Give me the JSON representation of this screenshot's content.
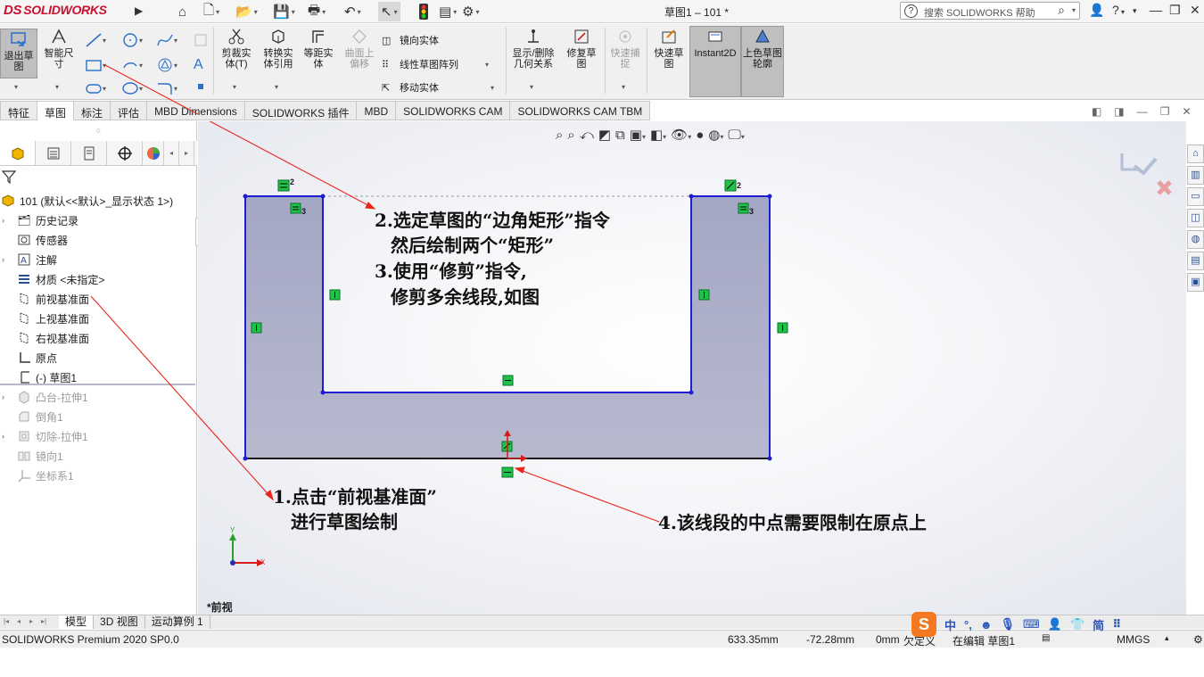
{
  "titlebar": {
    "logo_prefix": "DS",
    "logo_text": "SOLIDWORKS",
    "doc_title": "草图1 – 101 *",
    "help_placeholder": "搜索 SOLIDWORKS 帮助",
    "help_icon": "?"
  },
  "cmd": {
    "exit_sketch": "退出草图",
    "smart_dim": "智能尺寸",
    "trim": "剪裁实体(T)",
    "convert": "转换实体引用",
    "offset": "等距实体",
    "surface_offset": "曲面上偏移",
    "mirror": "镜向实体",
    "linear_pattern": "线性草图阵列",
    "move": "移动实体",
    "show_delete_rel": "显示/删除几何关系",
    "repair": "修复草图",
    "quick_snaps": "快速捕捉",
    "rapid_sketch": "快速草图",
    "instant2d": "Instant2D",
    "shaded_contours": "上色草图轮廓"
  },
  "tabs": [
    "特征",
    "草图",
    "标注",
    "评估",
    "MBD Dimensions",
    "SOLIDWORKS 插件",
    "MBD",
    "SOLIDWORKS CAM",
    "SOLIDWORKS CAM TBM"
  ],
  "active_tab": "草图",
  "tree": {
    "root": "101  (默认<<默认>_显示状态 1>)",
    "items": [
      {
        "label": "历史记录",
        "expand": true,
        "grey": false
      },
      {
        "label": "传感器",
        "expand": false,
        "grey": false
      },
      {
        "label": "注解",
        "expand": true,
        "grey": false
      },
      {
        "label": "材质 <未指定>",
        "expand": false,
        "grey": false
      },
      {
        "label": "前视基准面",
        "expand": false,
        "grey": false
      },
      {
        "label": "上视基准面",
        "expand": false,
        "grey": false
      },
      {
        "label": "右视基准面",
        "expand": false,
        "grey": false
      },
      {
        "label": "原点",
        "expand": false,
        "grey": false
      },
      {
        "label": "(-) 草图1",
        "expand": false,
        "grey": false
      },
      {
        "label": "凸台-拉伸1",
        "expand": true,
        "grey": true
      },
      {
        "label": "倒角1",
        "expand": false,
        "grey": true
      },
      {
        "label": "切除-拉伸1",
        "expand": true,
        "grey": true
      },
      {
        "label": "镜向1",
        "expand": false,
        "grey": true
      },
      {
        "label": "坐标系1",
        "expand": false,
        "grey": true
      }
    ]
  },
  "graphics": {
    "view_label": "*前视",
    "triad_x": "X",
    "triad_y": "Y",
    "relation_count_2": "2",
    "relation_count_3": "3"
  },
  "annotations": {
    "a1_line1": "1.点击“前视基准面”",
    "a1_line2": "进行草图绘制",
    "a2_line1": "2.选定草图的“边角矩形”指令",
    "a2_line2": "然后绘制两个“矩形”",
    "a3_line1": "3.使用“修剪”指令,",
    "a3_line2": "修剪多余线段,如图",
    "a4_line1": "4.该线段的中点需要限制在原点上"
  },
  "model_tabs": [
    "模型",
    "3D 视图",
    "运动算例 1"
  ],
  "active_model_tab": "模型",
  "status": {
    "product": "SOLIDWORKS Premium 2020 SP0.0",
    "x": "633.35mm",
    "y": "-72.28mm",
    "z": "0mm",
    "state": "欠定义",
    "editing": "在编辑 草图1",
    "units": "MMGS"
  },
  "ime": {
    "logo": "S",
    "lang": "中",
    "punct": "°,",
    "simp": "简"
  },
  "colors": {
    "sketch_line": "#1d1dd6",
    "sketch_fill": "#a7aac6",
    "relation_green": "#1fc34a",
    "annotation_arrow": "#e8261d",
    "brand_red": "#c8102e"
  }
}
